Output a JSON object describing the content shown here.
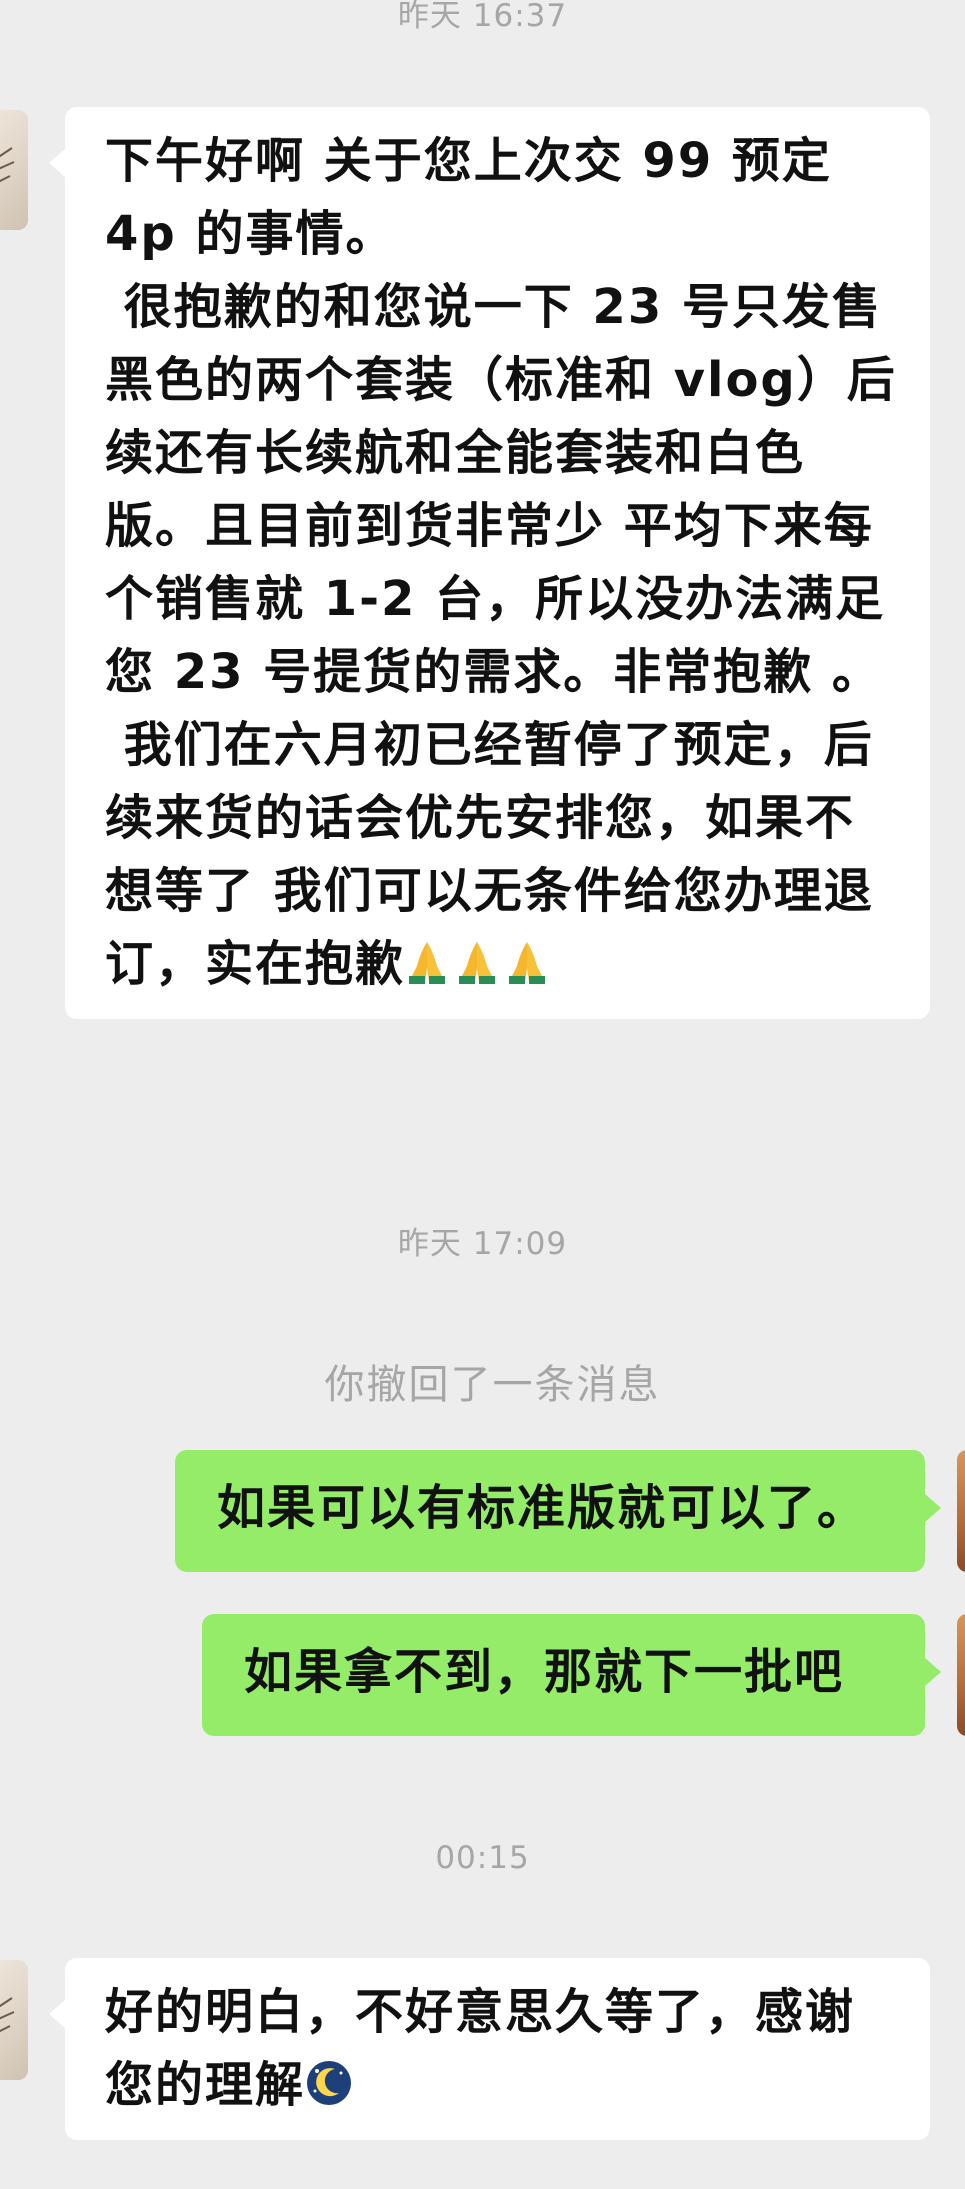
{
  "chat": {
    "timestamps": [
      "昨天 16:37",
      "昨天 17:09",
      "00:15"
    ],
    "recall_notice": "你撤回了一条消息",
    "messages": [
      {
        "sender": "other",
        "text": "下午好啊 关于您上次交 99 预定 4p 的事情。\n 很抱歉的和您说一下 23 号只发售黑色的两个套装（标准和 vlog）后续还有长续航和全能套装和白色版。且目前到货非常少 平均下来每个销售就 1-2 台，所以没办法满足您 23 号提货的需求。非常抱歉 。\n 我们在六月初已经暂停了预定，后续来货的话会优先安排您，如果不想等了 我们可以无条件给您办理退订，实在抱歉",
        "emoji": [
          "pray-emoji",
          "pray-emoji",
          "pray-emoji"
        ]
      },
      {
        "sender": "self",
        "text": "如果可以有标准版就可以了。"
      },
      {
        "sender": "self",
        "text": "如果拿不到，那就下一批吧"
      },
      {
        "sender": "other",
        "text": "好的明白，不好意思久等了，感谢您的理解",
        "emoji": [
          "moon-sleep-emoji"
        ]
      }
    ]
  }
}
